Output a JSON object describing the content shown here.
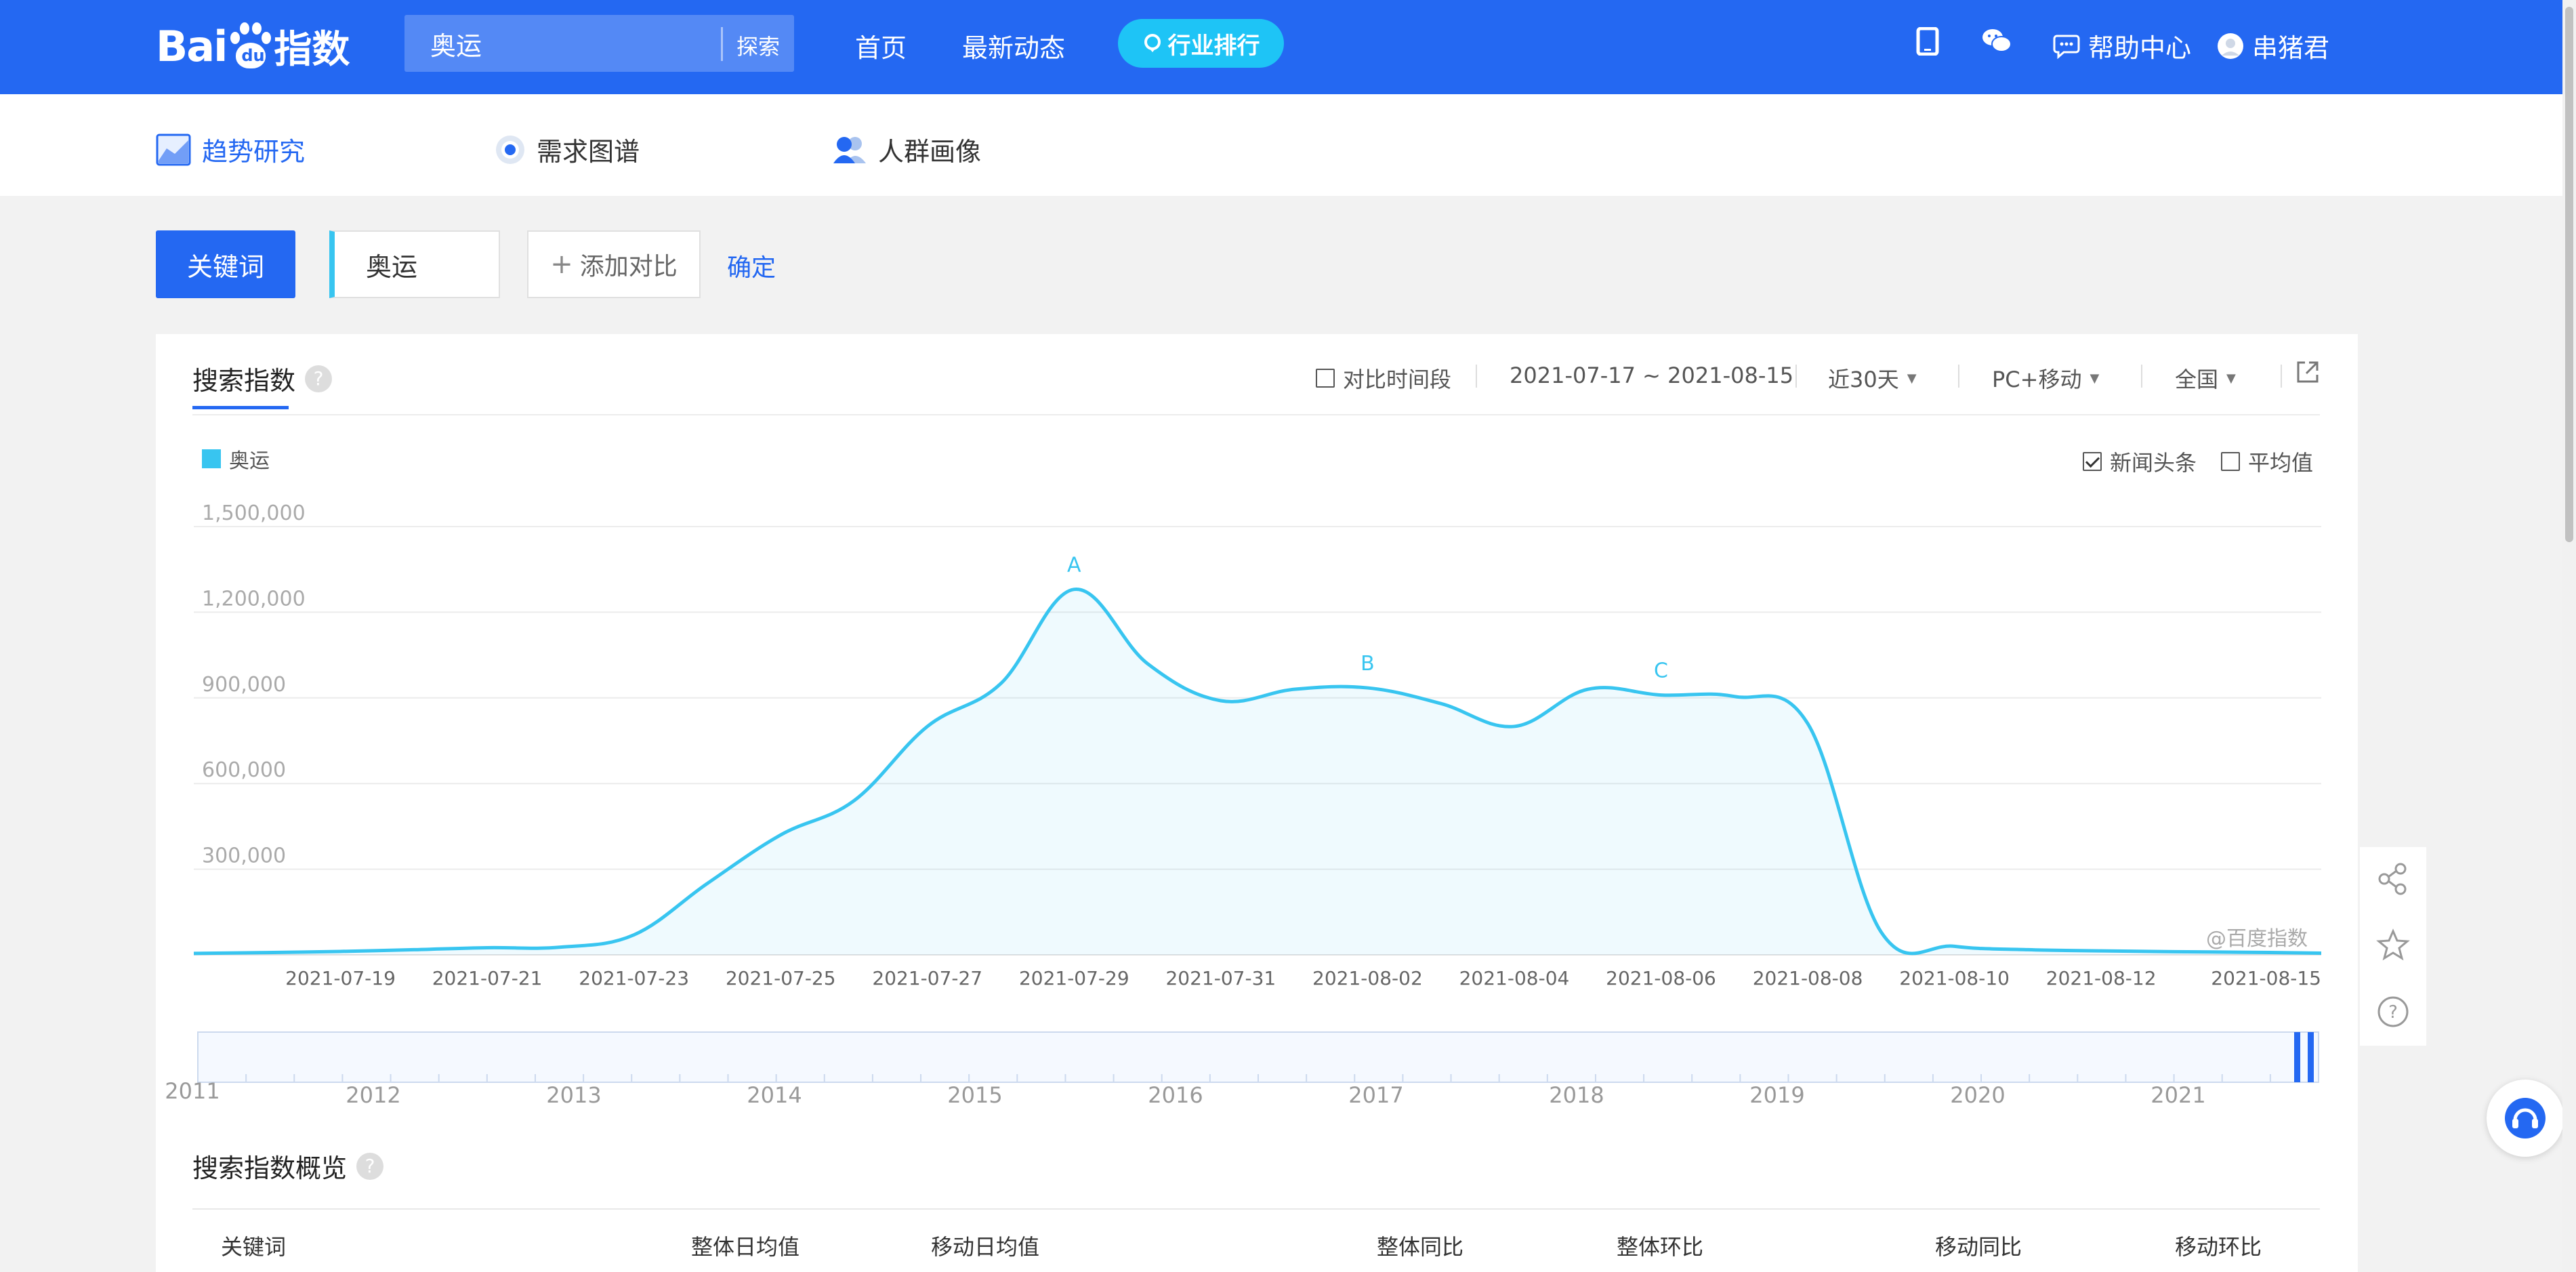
{
  "header": {
    "logo_text": "Bai",
    "logo_paw_text": "du",
    "logo_cn": "指数",
    "search_value": "奥运",
    "search_button": "探索",
    "nav": [
      "首页",
      "最新动态"
    ],
    "rank_button": "行业排行",
    "help": "帮助中心",
    "user": "串猪君"
  },
  "tabs": [
    {
      "label": "趋势研究",
      "active": true,
      "icon": "trend-icon"
    },
    {
      "label": "需求图谱",
      "active": false,
      "icon": "target-icon"
    },
    {
      "label": "人群画像",
      "active": false,
      "icon": "people-icon"
    }
  ],
  "keywords": {
    "label": "关键词",
    "current": "奥运",
    "add": "添加对比",
    "confirm": "确定"
  },
  "card": {
    "title": "搜索指数",
    "compare_period": "对比时间段",
    "date_range": "2021-07-17 ~ 2021-08-15",
    "period": "近30天",
    "device": "PC+移动",
    "region": "全国",
    "news_label": "新闻头条",
    "avg_label": "平均值",
    "watermark": "@百度指数"
  },
  "chart_data": {
    "type": "area",
    "series": [
      {
        "name": "奥运",
        "color": "#38c5f0",
        "x": [
          "2021-07-17",
          "2021-07-18",
          "2021-07-19",
          "2021-07-20",
          "2021-07-21",
          "2021-07-22",
          "2021-07-23",
          "2021-07-24",
          "2021-07-25",
          "2021-07-26",
          "2021-07-27",
          "2021-07-28",
          "2021-07-29",
          "2021-07-30",
          "2021-07-31",
          "2021-08-01",
          "2021-08-02",
          "2021-08-03",
          "2021-08-04",
          "2021-08-05",
          "2021-08-06",
          "2021-08-07",
          "2021-08-08",
          "2021-08-09",
          "2021-08-10",
          "2021-08-11",
          "2021-08-12",
          "2021-08-13",
          "2021-08-14",
          "2021-08-15"
        ],
        "values": [
          5000,
          8000,
          12000,
          18000,
          25000,
          27000,
          70000,
          250000,
          420000,
          540000,
          800000,
          950000,
          1280000,
          1020000,
          890000,
          930000,
          935000,
          880000,
          800000,
          930000,
          910000,
          905000,
          810000,
          80000,
          30000,
          18000,
          14000,
          11000,
          9000,
          6000
        ]
      }
    ],
    "x_ticks": [
      "2021-07-19",
      "2021-07-21",
      "2021-07-23",
      "2021-07-25",
      "2021-07-27",
      "2021-07-29",
      "2021-07-31",
      "2021-08-02",
      "2021-08-04",
      "2021-08-06",
      "2021-08-08",
      "2021-08-10",
      "2021-08-12",
      "2021-08-15"
    ],
    "y_ticks": [
      "1,500,000",
      "1,200,000",
      "900,000",
      "600,000",
      "300,000"
    ],
    "ylim": [
      0,
      1500000
    ],
    "annotations": [
      {
        "label": "A",
        "x": "2021-07-29"
      },
      {
        "label": "B",
        "x": "2021-08-02"
      },
      {
        "label": "C",
        "x": "2021-08-06"
      }
    ],
    "range_years": [
      "2011",
      "2012",
      "2013",
      "2014",
      "2015",
      "2016",
      "2017",
      "2018",
      "2019",
      "2020",
      "2021"
    ],
    "legend": "top-left",
    "grid": true
  },
  "overview": {
    "title": "搜索指数概览",
    "columns": [
      "关键词",
      "整体日均值",
      "移动日均值",
      "整体同比",
      "整体环比",
      "移动同比",
      "移动环比"
    ]
  },
  "colors": {
    "brand": "#2468f2",
    "series": "#38c5f0"
  }
}
